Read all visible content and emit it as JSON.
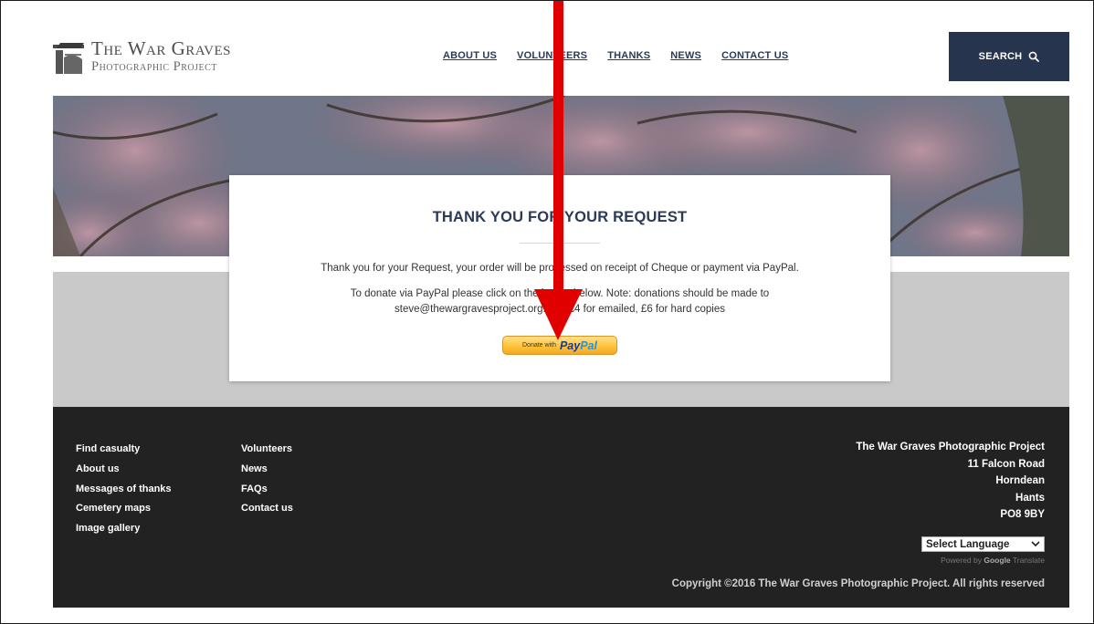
{
  "logo": {
    "line1": "The War Graves",
    "line2": "Photographic Project"
  },
  "nav": {
    "items": [
      {
        "label": "ABOUT US"
      },
      {
        "label": "VOLUNTEERS"
      },
      {
        "label": "THANKS"
      },
      {
        "label": "NEWS"
      },
      {
        "label": "CONTACT US"
      }
    ]
  },
  "search": {
    "label": "SEARCH",
    "icon": "search-icon"
  },
  "card": {
    "title": "THANK YOU FOR YOUR REQUEST",
    "p1": "Thank you for your Request, your order will be processed on receipt of Cheque or payment via PayPal.",
    "p2_line1": "To donate via PayPal please click on the button below. Note: donations should be made to",
    "p2_line2": "steve@thewargravesproject.org.uk – £4 for emailed, £6 for hard copies",
    "paypal_small": "Donate with",
    "paypal_pay": "Pay",
    "paypal_pal": "Pal"
  },
  "footer": {
    "col1": [
      "Find casualty",
      "About us",
      "Messages of thanks",
      "Cemetery maps",
      "Image gallery"
    ],
    "col2": [
      "Volunteers",
      "News",
      "FAQs",
      "Contact us"
    ],
    "address": [
      "The War Graves Photographic Project",
      "11 Falcon Road",
      "Horndean",
      "Hants",
      "PO8 9BY"
    ],
    "language_select": "Select Language",
    "powered_by": "Powered by",
    "google": "Google",
    "translate": "Translate",
    "copyright": "Copyright ©2016 The War Graves Photographic Project. All rights reserved"
  },
  "colors": {
    "navy": "#27344d",
    "footer_bg": "#222222",
    "annotation_arrow": "#e00000",
    "paypal_gold": "#ffc43a"
  }
}
